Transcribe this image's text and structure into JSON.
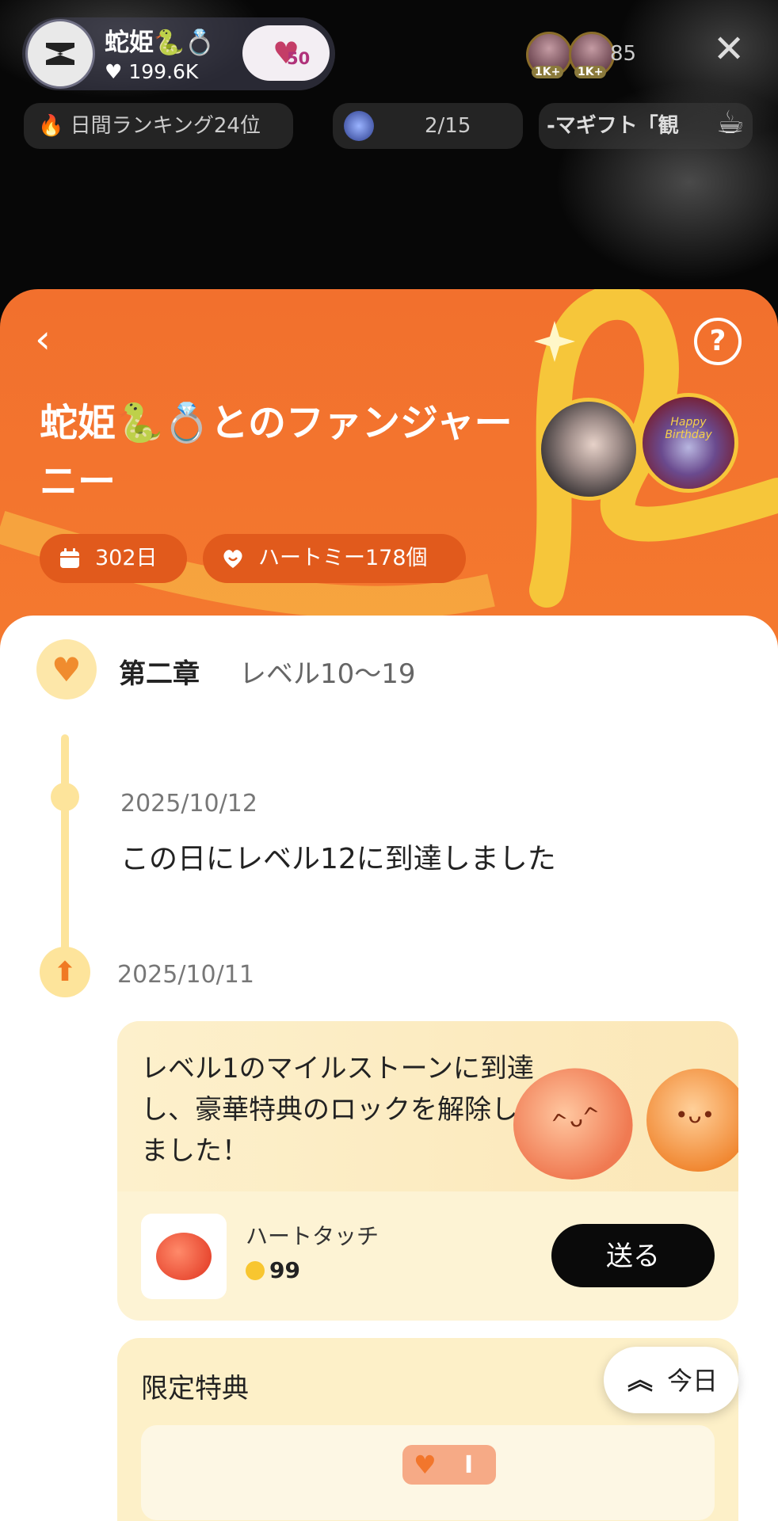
{
  "live": {
    "host_name": "蛇姫🐍💍",
    "host_likes": "♥ 199.6K",
    "badge_level": "50",
    "viewer1_badge": "1K+",
    "viewer2_badge": "1K+",
    "viewer_count": "85",
    "ranking_chip": "🔥 日間ランキング24位",
    "fireworks_progress": "2/15",
    "gift_ticker": "-マギフト「観"
  },
  "sheet": {
    "title": "蛇姫🐍💍とのファンジャーニー",
    "days_label": "302日",
    "hearts_label": "ハートミー178個"
  },
  "timeline": {
    "chapter_title": "第二章",
    "chapter_range": "レベル10〜19",
    "entry1_date": "2025/10/12",
    "entry1_text": "この日にレベル12に到達しました",
    "entry2_date": "2025/10/11",
    "milestone_text": "レベル1のマイルストーンに到達し、豪華特典のロックを解除しました！",
    "gift_name": "ハートタッチ",
    "gift_price": "99",
    "send_label": "送る",
    "perk_title": "限定特典",
    "perk_count": "I"
  },
  "floating": {
    "today_label": "今日"
  },
  "avatar_fan_text": "Happy Birthday",
  "colors": {
    "accent_orange": "#f2702d",
    "ribbon_gold": "#f6c63a",
    "timeline_yellow": "#fde49b"
  }
}
